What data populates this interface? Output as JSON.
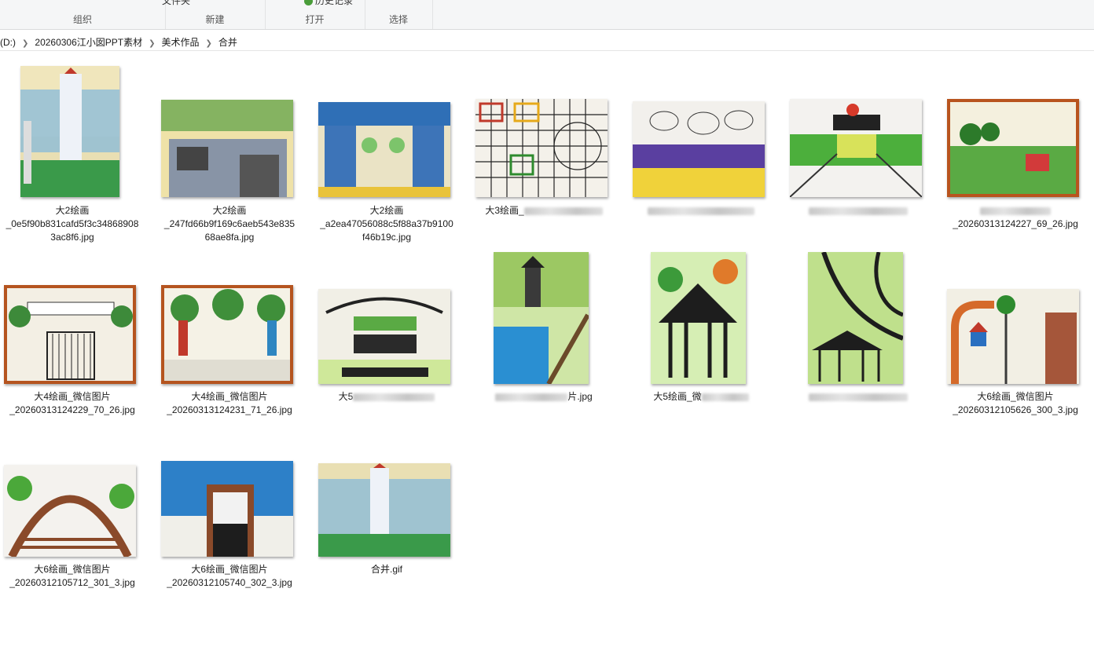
{
  "ribbon": {
    "groups": [
      {
        "label": "组织",
        "clipped": ""
      },
      {
        "label": "新建",
        "clipped": "文件夹"
      },
      {
        "label": "打开",
        "clipped": "历史记录"
      },
      {
        "label": "选择",
        "clipped": ""
      }
    ]
  },
  "breadcrumb": [
    "(D:)",
    "20260306江小囡PPT素材",
    "美术作品",
    "合并"
  ],
  "files": [
    {
      "name": "大2绘画\n_0e5f90b831cafd5f3c34868908\n3ac8f6.jpg"
    },
    {
      "name": "大2绘画\n_247fd66b9f169c6aeb543e835\n68ae8fa.jpg"
    },
    {
      "name": "大2绘画\n_a2ea47056088c5f88a37b9100\nf46b19c.jpg"
    },
    {
      "name": "大3绘画_"
    },
    {
      "name": ""
    },
    {
      "name": ""
    },
    {
      "name": "_20260313124227_69_26.jpg"
    },
    {
      "name": "大4绘画_微信图片\n_20260313124229_70_26.jpg"
    },
    {
      "name": "大4绘画_微信图片\n_20260313124231_71_26.jpg"
    },
    {
      "name": "大5"
    },
    {
      "name": "片.jpg"
    },
    {
      "name": "大5绘画_微"
    },
    {
      "name": ""
    },
    {
      "name": "大6绘画_微信图片\n_20260312105626_300_3.jpg"
    },
    {
      "name": "大6绘画_微信图片\n_20260312105712_301_3.jpg"
    },
    {
      "name": "大6绘画_微信图片\n_20260312105740_302_3.jpg"
    },
    {
      "name": "合并.gif"
    }
  ]
}
